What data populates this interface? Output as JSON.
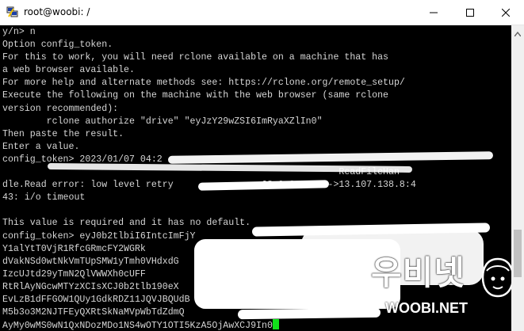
{
  "window": {
    "title": "root@woobi: /"
  },
  "terminal": {
    "lines": [
      "y/n> n",
      "Option config_token.",
      "For this to work, you will need rclone available on a machine that has",
      "a web browser available.",
      "For more help and alternate methods see: https://rclone.org/remote_setup/",
      "Execute the following on the machine with the web browser (same rclone",
      "version recommended):",
      "        rclone authorize \"drive\" \"eyJzY29wZSI6ImRyaXZlIn0\"",
      "Then paste the result.",
      "Enter a value.",
      "config_token> 2023/01/07 04:2",
      "                                                             ReadFileHan",
      "dle.Read error: low level retry                68.0.3:55724->13.107.138.8:4",
      "43: i/o timeout",
      "",
      "This value is required and it has no default.",
      "config_token> eyJ0b2tlbiI6IntcImFjY",
      "Y1alYtT0VjR1RfcGRmcFY2WGRk",
      "dVakNSd0wtNkVmTUpSMW1yTmh0VHdxdG",
      "IzcUJtd29yTmN2QlVWWXh0cUFF",
      "RtRlAyNGcwMTYzXCIsXCJ0b2tlb190eX",
      "EvLzB1dFFGOW1QUy1GdkRDZ11JQVJBQUdB",
      "M5b3o3M2NJTFEyQXRtSkNaMVpWbTdZdmQ",
      "AyMy0wMS0wN1QxNDozMDo1NS4wOTY1OTI5KzA5OjAwXCJ9In0"
    ]
  },
  "watermark": {
    "korean": "우비넷",
    "url": "WOOBI.NET"
  },
  "icons": {
    "app": "putty-icon",
    "minimize": "minimize-icon",
    "maximize": "maximize-icon",
    "close": "close-icon"
  },
  "colors": {
    "terminal_bg": "#000000",
    "terminal_fg": "#d6d6d6",
    "cursor": "#11e01a"
  }
}
